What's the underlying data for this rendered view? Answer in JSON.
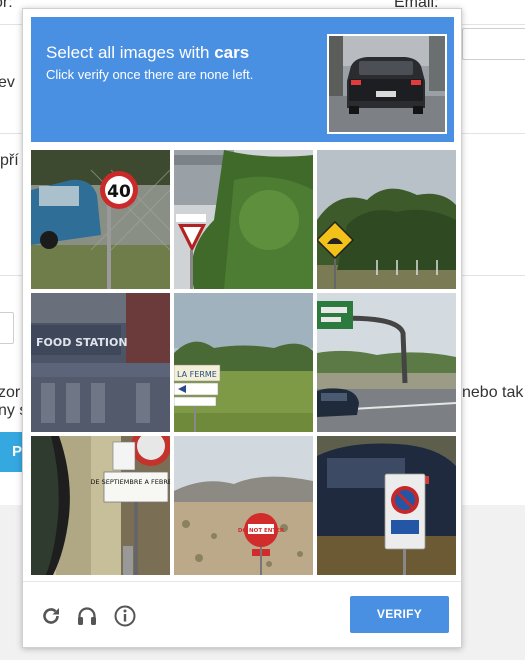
{
  "background": {
    "label_top_left": "or:",
    "label_email": "Email:",
    "label_name": "ev",
    "label_pri": "pří",
    "label_zor": "zor",
    "label_ny": "ny s",
    "label_nebo": "nebo tak",
    "button_text": "P"
  },
  "captcha": {
    "instruction_prefix": "Select all images with ",
    "instruction_target": "cars",
    "instruction_sub": "Click verify once there are none left.",
    "verify_label": "VERIFY",
    "icons": [
      "reload-icon",
      "audio-icon",
      "info-icon"
    ],
    "accent_color": "#4a90e2",
    "tiles": [
      {
        "scene": "blue car and speed limit sign",
        "sign_text": "40"
      },
      {
        "scene": "yield sign among trees",
        "sign_text": ""
      },
      {
        "scene": "yellow warning sign near trees",
        "sign_text": ""
      },
      {
        "scene": "building storefront",
        "sign_text": "FOOD STATION"
      },
      {
        "scene": "direction sign in field",
        "sign_text": "LA FERME"
      },
      {
        "scene": "green overhead road sign on highway",
        "sign_text": ""
      },
      {
        "scene": "street sign close up",
        "sign_text": "DE SEPTIEMBRE A FEBRERO"
      },
      {
        "scene": "do not enter sign in desert",
        "sign_text": "DO NOT ENTER"
      },
      {
        "scene": "car behind no parking sign",
        "sign_text": ""
      }
    ]
  }
}
